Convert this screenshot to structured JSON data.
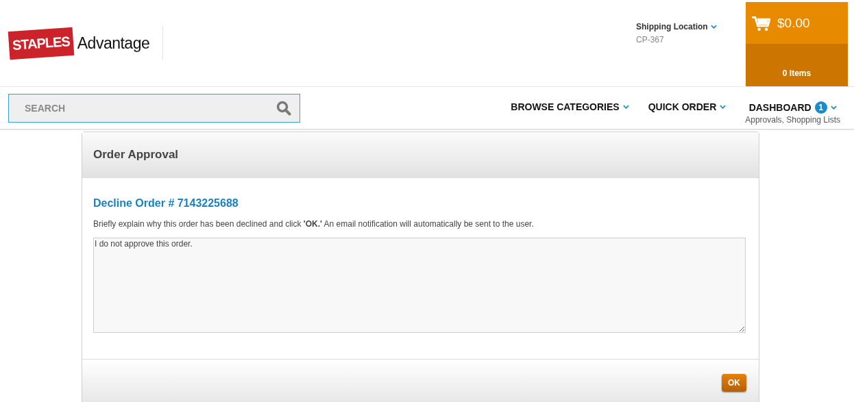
{
  "logo": {
    "brand": "STAPLES",
    "product": "Advantage"
  },
  "shipping": {
    "label": "Shipping Location",
    "value": "CP-367"
  },
  "cart": {
    "total": "$0.00",
    "items": "0 Items"
  },
  "search": {
    "placeholder": "SEARCH"
  },
  "nav": [
    {
      "label": "BROWSE CATEGORIES"
    },
    {
      "label": "QUICK ORDER"
    },
    {
      "label": "DASHBOARD",
      "badge": "1",
      "sub": "Approvals, Shopping Lists"
    }
  ],
  "dialog": {
    "title": "Order Approval",
    "heading": "Decline Order # 7143225688",
    "instructions": "Briefly explain why this order has been declined and click **'OK.'** An email notification will automatically be sent to the user.",
    "message": "I do not approve this order.",
    "buttons": [
      "OK"
    ]
  }
}
